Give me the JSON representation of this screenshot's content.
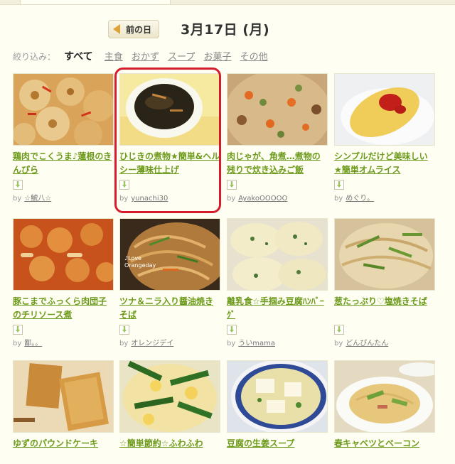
{
  "date_nav": {
    "prev_label": "前の日",
    "date_title": "3月17日 (月)"
  },
  "filter": {
    "label": "絞り込み：",
    "current": "すべて",
    "links": [
      "主食",
      "おかず",
      "スープ",
      "お菓子",
      "その他"
    ]
  },
  "by_label": "by",
  "recipes": [
    {
      "title": "鶏肉でこくうま♪蓮根のきんぴら",
      "author": "☆鯱八☆"
    },
    {
      "title": "ひじきの煮物★簡単&ヘルシー薄味仕上げ",
      "author": "yunachi30"
    },
    {
      "title": "肉じゃが、角煮…煮物の残りで炊き込みご飯",
      "author": "AyakoOOOOO"
    },
    {
      "title": "シンプルだけど美味しい★簡単オムライス",
      "author": "めぐり。"
    },
    {
      "title": "豚こまでふっくら肉団子のチリソース煮",
      "author": "鄙。。"
    },
    {
      "title": "ツナ＆ニラ入り醤油焼きそば",
      "author": "オレンジデイ"
    },
    {
      "title": "離乳食☆手掴み豆腐ﾊﾝﾊﾞｰｸﾞ",
      "author": "ういmama"
    },
    {
      "title": "葱たっぷり♡塩焼きそば",
      "author": "どんぴんたん"
    },
    {
      "title": "ゆずのパウンドケーキ",
      "author": ""
    },
    {
      "title": "☆簡単節約☆ふわふわ",
      "author": ""
    },
    {
      "title": "豆腐の生姜スープ",
      "author": ""
    },
    {
      "title": "春キャベツとベーコン",
      "author": ""
    }
  ],
  "thumb_text": {
    "r2c2": "♪Love Orangeday"
  },
  "colors": {
    "link_green": "#6c9a1a",
    "highlight_red": "#d41c2c",
    "page_bg": "#fffef3",
    "prev_arrow": "#e0a238"
  }
}
